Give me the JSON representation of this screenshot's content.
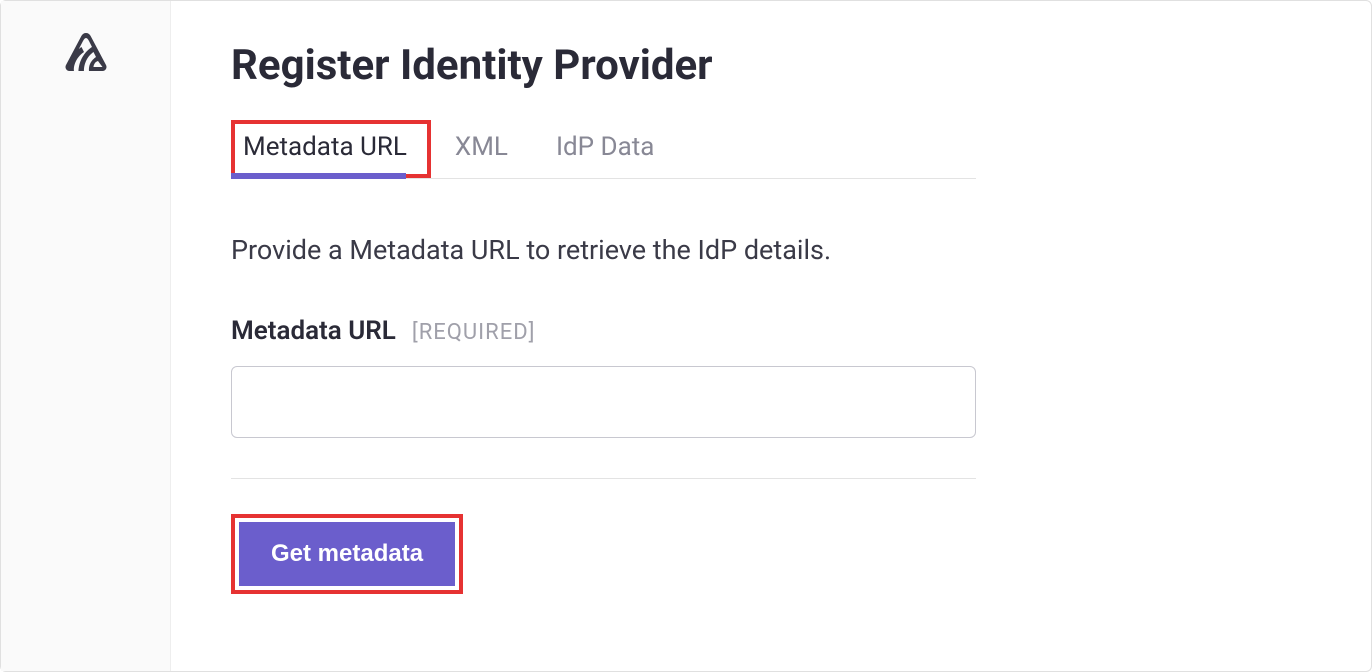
{
  "page": {
    "title": "Register Identity Provider"
  },
  "tabs": {
    "items": [
      {
        "label": "Metadata URL",
        "active": true
      },
      {
        "label": "XML",
        "active": false
      },
      {
        "label": "IdP Data",
        "active": false
      }
    ]
  },
  "form": {
    "description": "Provide a Metadata URL to retrieve the IdP details.",
    "field_label": "Metadata URL",
    "field_required_text": "[REQUIRED]",
    "field_value": ""
  },
  "actions": {
    "submit_label": "Get metadata"
  }
}
